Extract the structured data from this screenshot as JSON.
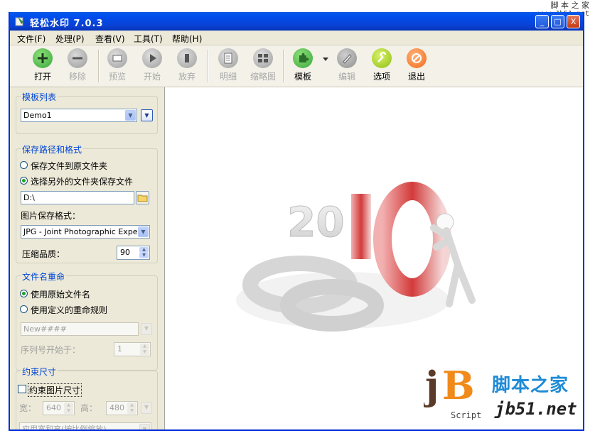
{
  "watermark_top": {
    "line1": "脚 本 之 家",
    "line2": "www.Jb51.net"
  },
  "window": {
    "title": "轻松水印 7.0.3",
    "min": "_",
    "max": "□",
    "close": "X"
  },
  "menu": [
    "文件(F)",
    "处理(P)",
    "查看(V)",
    "工具(T)",
    "帮助(H)"
  ],
  "toolbar": {
    "open": "打开",
    "remove": "移除",
    "preview": "预览",
    "start": "开始",
    "abort": "放弃",
    "detail": "明细",
    "thumbnail": "缩略图",
    "template": "模板",
    "edit": "编辑",
    "options": "选项",
    "exit": "退出"
  },
  "template_list": {
    "title": "模板列表",
    "selected": "Demo1"
  },
  "save": {
    "title": "保存路径和格式",
    "radio1": "保存文件到原文件夹",
    "radio2": "选择另外的文件夹保存文件",
    "path": "D:\\",
    "format_label": "图片保存格式：",
    "format": "JPG - Joint Photographic Experts G",
    "quality_label": "压缩品质：",
    "quality": "90"
  },
  "rename": {
    "title": "文件名重命",
    "radio1": "使用原始文件名",
    "radio2": "使用定义的重命规则",
    "pattern": "New####",
    "seq_label": "序列号开始于：",
    "seq": "1"
  },
  "constraint": {
    "title": "约束尺寸",
    "checkbox": "约束图片尺寸",
    "width_label": "宽：",
    "width": "640",
    "height_label": "高：",
    "height": "480",
    "mode": "应用宽和高(按比例缩放)"
  },
  "preview_image": {
    "year": "2010",
    "old_year": "09"
  },
  "watermark_logo": {
    "jb": "jB",
    "script": "Script",
    "name": "脚本之家",
    "url": "jb51.net"
  },
  "colors": {
    "title_blue": "#0a3fd0",
    "group_title": "#0046d5",
    "red_10": "#d33b3b",
    "green_ok": "#39a73a",
    "orange_exit": "#f26a1b"
  }
}
